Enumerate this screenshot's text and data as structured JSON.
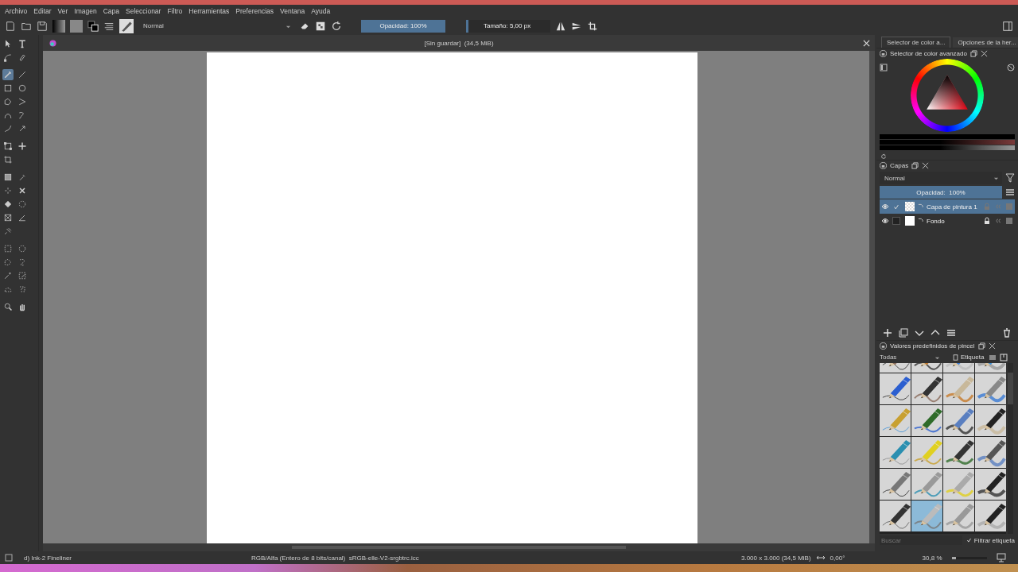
{
  "menu": [
    "Archivo",
    "Editar",
    "Ver",
    "Imagen",
    "Capa",
    "Seleccionar",
    "Filtro",
    "Herramientas",
    "Preferencias",
    "Ventana",
    "Ayuda"
  ],
  "toolbar": {
    "blend_mode": "Normal",
    "opacity": {
      "label": "Opacidad: 100%",
      "level": 1
    },
    "size": {
      "label": "Tamaño: 5,00 px",
      "level": 0.03
    }
  },
  "document": {
    "title": "[Sin guardar]  (34,5 MiB)"
  },
  "tools": [
    {
      "selected": false
    },
    {
      "selected": false
    },
    {
      "selected": false
    },
    {
      "selected": false
    },
    {
      "selected": true
    },
    {
      "selected": false
    },
    {
      "selected": false
    },
    {
      "selected": false
    },
    {
      "selected": false
    },
    {
      "selected": false
    },
    {
      "selected": false
    },
    {
      "selected": false
    },
    {
      "selected": false
    },
    {
      "selected": false
    },
    {
      "selected": false
    },
    {
      "selected": false
    },
    {
      "selected": false
    },
    {
      "selected": false
    },
    {
      "selected": false
    },
    {
      "selected": false
    },
    {
      "selected": false
    },
    {
      "selected": false
    },
    {
      "selected": false
    },
    {
      "selected": false
    },
    {
      "selected": false
    },
    {
      "selected": false
    },
    {
      "selected": false
    },
    {
      "selected": false
    },
    {
      "selected": false
    },
    {
      "selected": false
    },
    {
      "selected": false
    },
    {
      "selected": false
    },
    {
      "selected": false
    },
    {
      "selected": false
    },
    {
      "selected": false
    },
    {
      "selected": false
    }
  ],
  "dock_tabs": [
    {
      "label": "Selector de color a...",
      "selected": true
    },
    {
      "label": "Opciones de la her...",
      "selected": false
    }
  ],
  "color_docker": {
    "title": "Selector de color avanzado"
  },
  "layers_docker": {
    "title": "Capas",
    "blend_mode": "Normal",
    "opacity": {
      "label": "Opacidad:  100%",
      "level": 1
    },
    "layers": [
      {
        "name": "Capa de pintura 1",
        "selected": true,
        "visible": true,
        "checked": true,
        "locked": false,
        "transparent": true
      },
      {
        "name": "Fondo",
        "selected": false,
        "visible": true,
        "checked": false,
        "locked": true,
        "transparent": false
      }
    ]
  },
  "presets_docker": {
    "title": "Valores predefinidos de pincel",
    "tag_filter": "Todas",
    "tag_button": "Etiqueta",
    "search_placeholder": "Buscar",
    "filter_tag": {
      "label": "Filtrar etiqueta",
      "checked": true
    },
    "presets": [
      {
        "selected": false
      },
      {
        "selected": false
      },
      {
        "selected": false
      },
      {
        "selected": false
      },
      {
        "selected": false
      },
      {
        "selected": false
      },
      {
        "selected": false
      },
      {
        "selected": false
      },
      {
        "selected": false
      },
      {
        "selected": false
      },
      {
        "selected": false
      },
      {
        "selected": false
      },
      {
        "selected": false
      },
      {
        "selected": false
      },
      {
        "selected": false
      },
      {
        "selected": false
      },
      {
        "selected": false
      },
      {
        "selected": false
      },
      {
        "selected": false
      },
      {
        "selected": false
      },
      {
        "selected": false
      },
      {
        "selected": true
      },
      {
        "selected": false
      },
      {
        "selected": false
      }
    ]
  },
  "status_bar": {
    "brush": "d) Ink-2 Fineliner",
    "color_space": "RGB/Alfa (Entero de 8 bits/canal)  sRGB-elle-V2-srgbtrc.icc",
    "image_size": "3.000 x 3.000 (34,5 MiB)",
    "rotation": "0,00°",
    "zoom": "30,8 %",
    "zoom_slider": {
      "level": 0.12
    }
  }
}
